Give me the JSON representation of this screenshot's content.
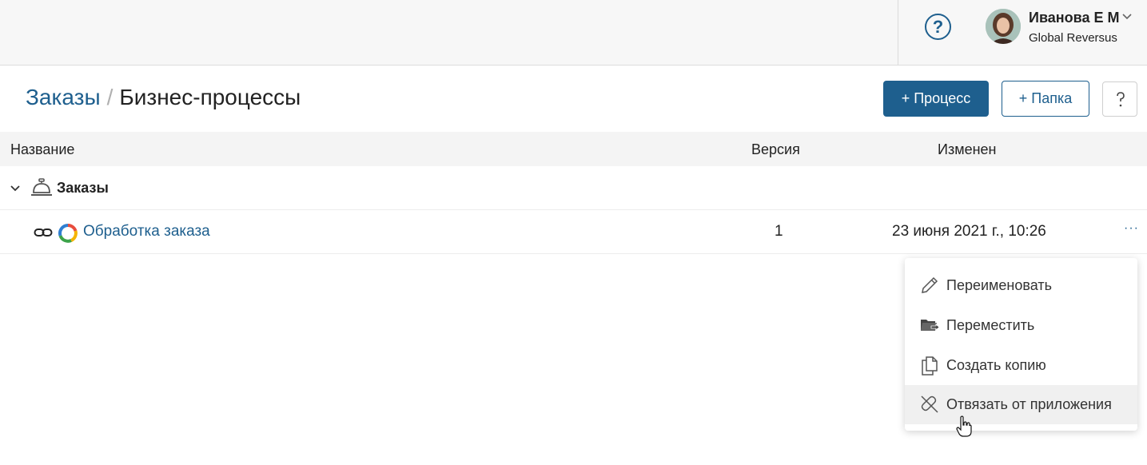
{
  "topbar": {
    "help_icon": "question-circle-icon",
    "user": {
      "name": "Иванова Е М",
      "org": "Global Reversus"
    }
  },
  "header": {
    "breadcrumb_parent": "Заказы",
    "breadcrumb_separator": "/",
    "title": "Бизнес-процессы",
    "btn_process": "+ Процесс",
    "btn_folder": "+ Папка",
    "help_icon": "question-small-icon"
  },
  "table": {
    "columns": [
      "Название",
      "Версия",
      "Изменен"
    ],
    "group": {
      "label": "Заказы",
      "icon": "service-bell-icon"
    },
    "rows": [
      {
        "name": "Обработка заказа",
        "version": "1",
        "modified": "23 июня 2021 г., 10:26",
        "more": "···"
      }
    ]
  },
  "context_menu": {
    "items": [
      {
        "label": "Переименовать",
        "icon": "pencil-icon"
      },
      {
        "label": "Переместить",
        "icon": "folder-move-icon"
      },
      {
        "label": "Создать копию",
        "icon": "copy-icon"
      },
      {
        "label": "Отвязать от приложения",
        "icon": "unlink-icon"
      }
    ]
  },
  "colors": {
    "accent": "#1e5f8e",
    "topbar_bg": "#f7f7f7",
    "table_header_bg": "#f4f4f4",
    "menu_hover_bg": "#f0f0f0"
  }
}
